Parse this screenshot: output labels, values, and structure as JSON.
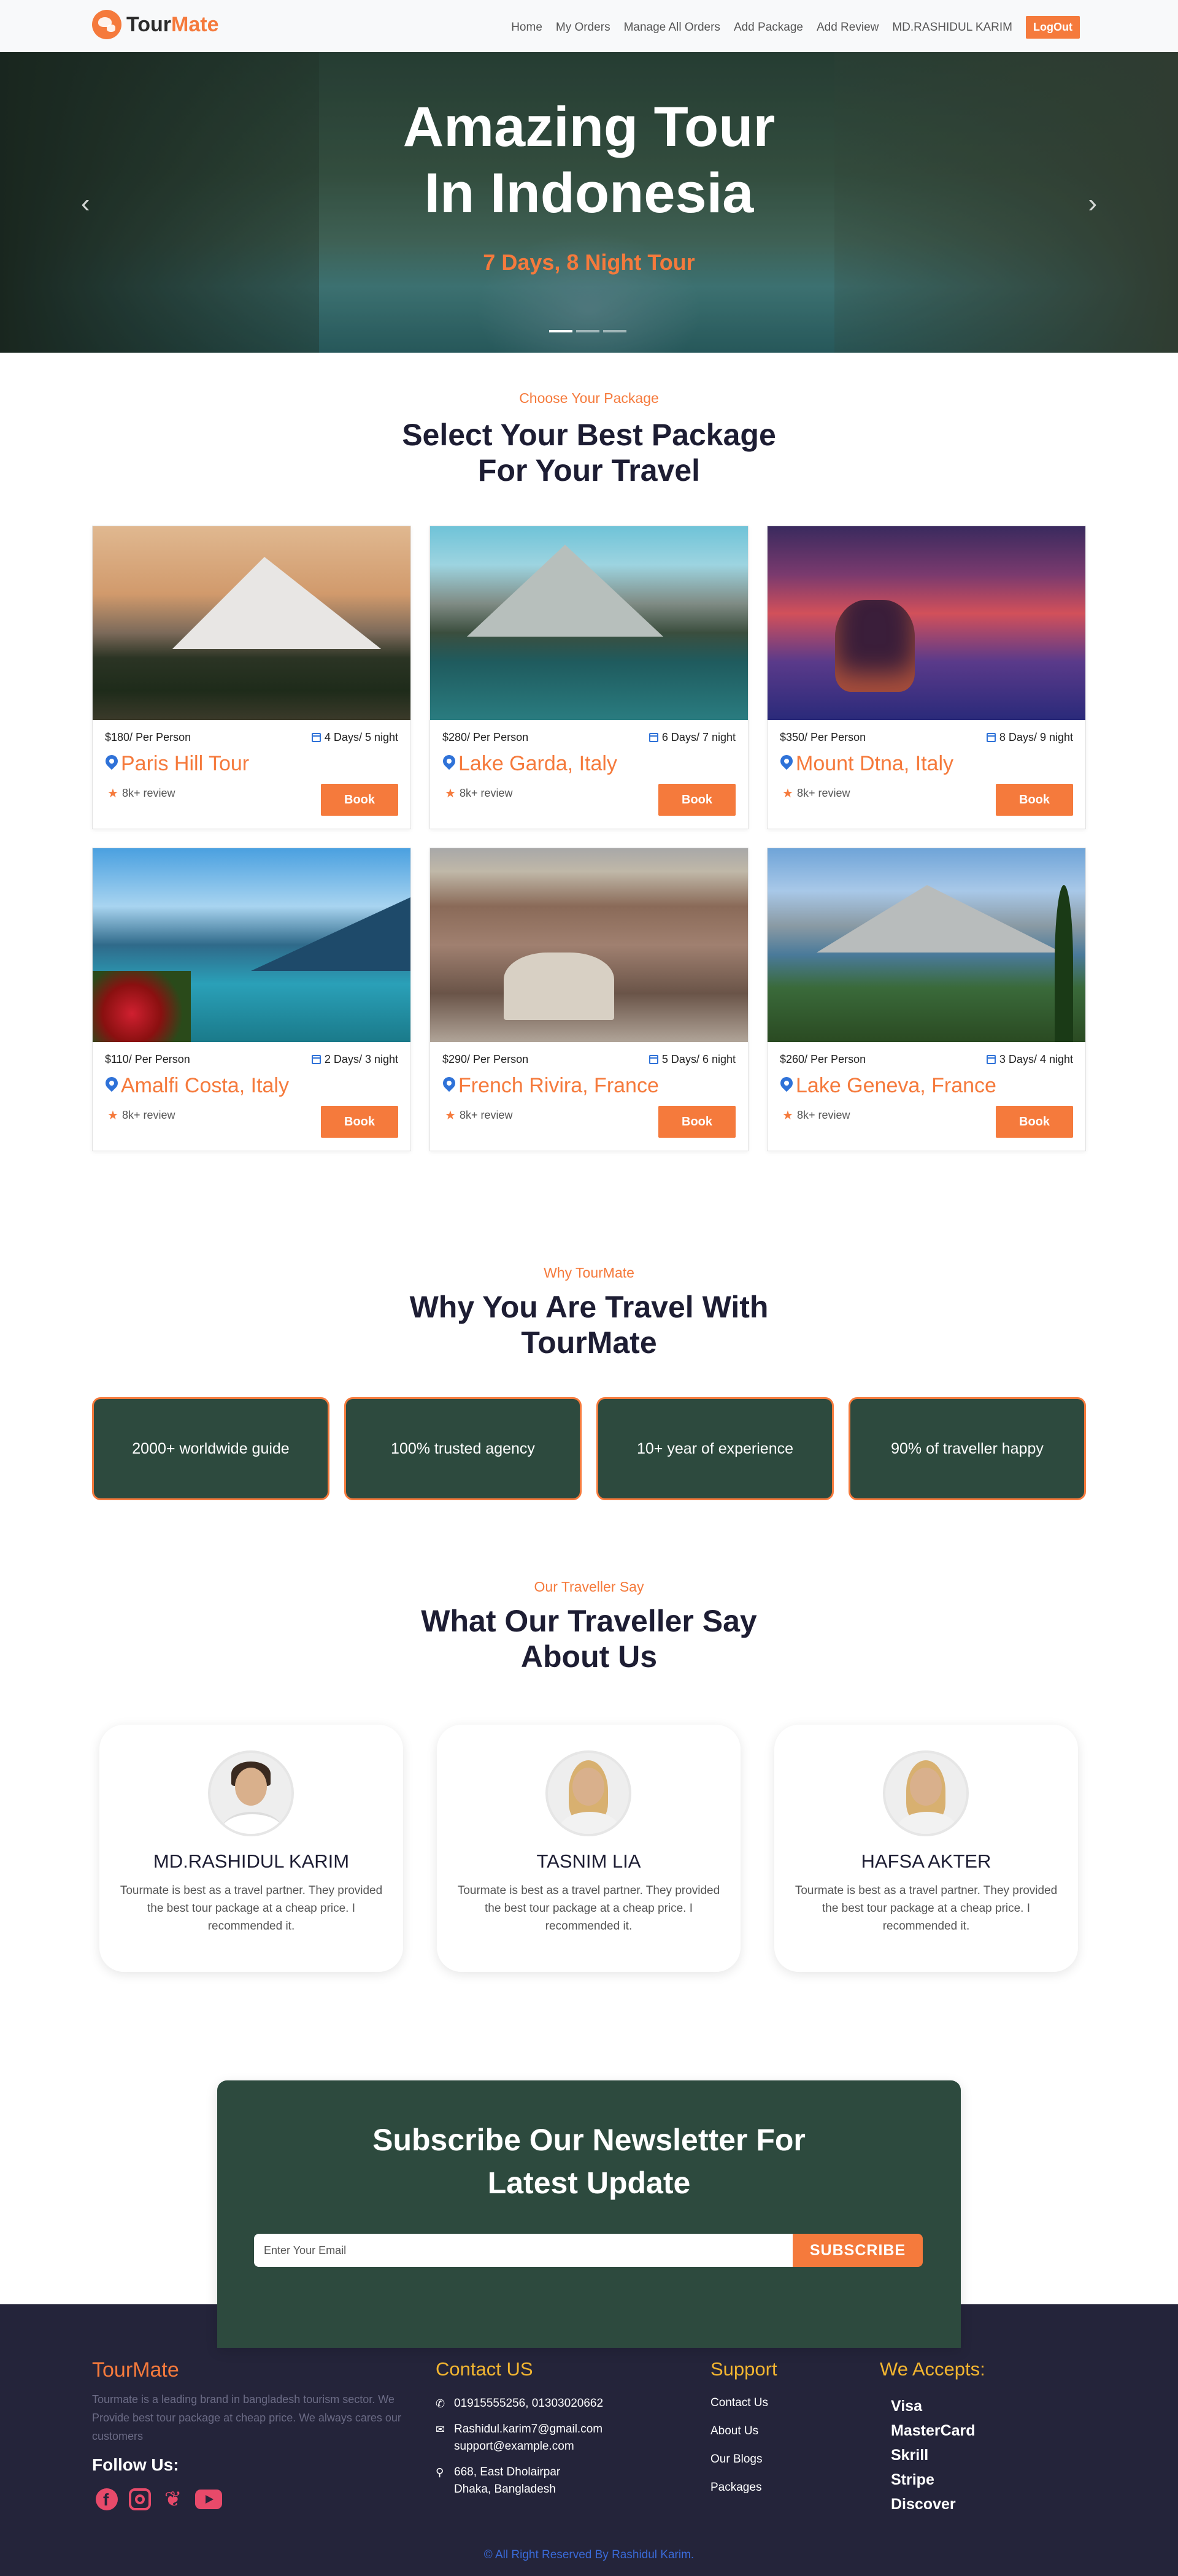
{
  "nav": {
    "brand_prefix": "Tour",
    "brand_suffix": "Mate",
    "links": [
      "Home",
      "My Orders",
      "Manage All Orders",
      "Add Package",
      "Add Review",
      "MD.RASHIDUL KARIM"
    ],
    "logout_label": "LogOut"
  },
  "hero": {
    "title_line1": "Amazing Tour",
    "title_line2": "In Indonesia",
    "subtitle": "7 Days, 8 Night Tour",
    "prev_icon": "chevron-left-icon",
    "next_icon": "chevron-right-icon",
    "slides": 3,
    "active_slide": 1
  },
  "packages_section": {
    "kicker": "Choose Your Package",
    "title_line1": "Select Your Best Package",
    "title_line2": "For Your Travel"
  },
  "packages": [
    {
      "price": "$180/ Per Person",
      "duration": "4 Days/ 5 night",
      "name": "Paris Hill Tour",
      "review": "8k+ review",
      "book": "Book"
    },
    {
      "price": "$280/ Per Person",
      "duration": "6 Days/ 7 night",
      "name": "Lake Garda, Italy",
      "review": "8k+ review",
      "book": "Book"
    },
    {
      "price": "$350/ Per Person",
      "duration": "8 Days/ 9 night",
      "name": "Mount Dtna, Italy",
      "review": "8k+ review",
      "book": "Book"
    },
    {
      "price": "$110/ Per Person",
      "duration": "2 Days/ 3 night",
      "name": "Amalfi Costa, Italy",
      "review": "8k+ review",
      "book": "Book"
    },
    {
      "price": "$290/ Per Person",
      "duration": "5 Days/ 6 night",
      "name": "French Rivira, France",
      "review": "8k+ review",
      "book": "Book"
    },
    {
      "price": "$260/ Per Person",
      "duration": "3 Days/ 4 night",
      "name": "Lake Geneva, France",
      "review": "8k+ review",
      "book": "Book"
    }
  ],
  "why_section": {
    "kicker": "Why TourMate",
    "title_line1": "Why You Are Travel With",
    "title_line2": "TourMate",
    "cards": [
      "2000+ worldwide guide",
      "100% trusted agency",
      "10+ year of experience",
      "90% of traveller happy"
    ]
  },
  "testimonials_section": {
    "kicker": "Our Traveller Say",
    "title_line1": "What Our Traveller Say",
    "title_line2": "About Us",
    "items": [
      {
        "name": "MD.RASHIDUL KARIM",
        "text": "Tourmate is best as a travel partner. They provided the best tour package at a cheap price. I recommended it."
      },
      {
        "name": "TASNIM LIA",
        "text": "Tourmate is best as a travel partner. They provided the best tour package at a cheap price. I recommended it."
      },
      {
        "name": "HAFSA AKTER",
        "text": "Tourmate is best as a travel partner. They provided the best tour package at a cheap price. I recommended it."
      }
    ]
  },
  "newsletter": {
    "title_line1": "Subscribe Our Newsletter For",
    "title_line2": "Latest Update",
    "placeholder": "Enter Your Email",
    "button": "SUBSCRIBE"
  },
  "footer": {
    "brand": "TourMate",
    "description": "Tourmate is a leading brand in bangladesh tourism sector. We Provide best tour package at cheap price. We always cares our customers",
    "follow_label": "Follow Us:",
    "contact_heading": "Contact US",
    "phone": "01915555256, 01303020662",
    "email_line1": "Rashidul.karim7@gmail.com",
    "email_line2": "support@example.com",
    "address_line1": "668, East Dholairpar",
    "address_line2": "Dhaka, Bangladesh",
    "support_heading": "Support",
    "support_links": [
      "Contact Us",
      "About Us",
      "Our Blogs",
      "Packages"
    ],
    "accepts_heading": "We Accepts:",
    "accepts": [
      "Visa",
      "MasterCard",
      "Skrill",
      "Stripe",
      "Discover"
    ],
    "copyright": "© All Right Reserved By Rashidul Karim."
  },
  "colors": {
    "accent": "#f57a3c",
    "dark_green": "#2d4a3e",
    "footer_bg": "#24243a",
    "footer_heading": "#f2b530",
    "icon_blue": "#2f72d8"
  }
}
